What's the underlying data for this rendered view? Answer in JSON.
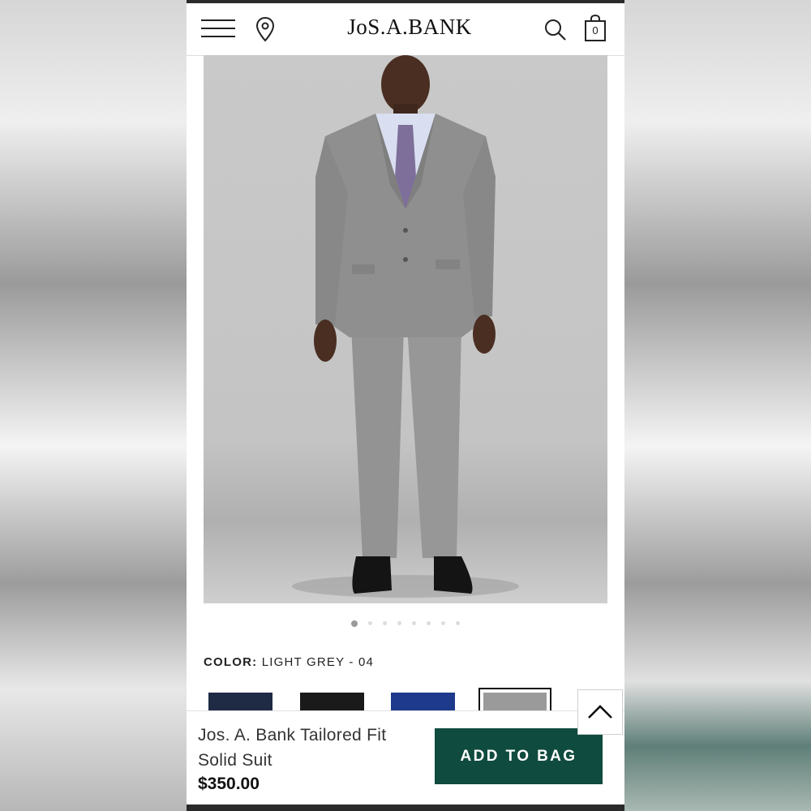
{
  "header": {
    "logo_text": "JoS.A.BANK",
    "bag_count": "0",
    "icons": [
      "hamburger-menu-icon",
      "location-pin-icon",
      "search-icon",
      "shopping-bag-icon"
    ]
  },
  "gallery": {
    "image_description": "Model wearing light grey two-button suit with white shirt and purple patterned tie",
    "total_images": 8,
    "active_index": 0
  },
  "color": {
    "label": "COLOR:",
    "value": "LIGHT GREY - 04",
    "swatches": [
      {
        "name": "navy",
        "hex": "#1f2a44"
      },
      {
        "name": "black",
        "hex": "#1a1a1a"
      },
      {
        "name": "blue",
        "hex": "#1e3a8c"
      },
      {
        "name": "light grey",
        "hex": "#9a9a9a",
        "selected": true
      }
    ]
  },
  "product": {
    "name": "Jos. A. Bank Tailored Fit Solid Suit",
    "price": "$350.00"
  },
  "cta": {
    "add_to_bag_label": "ADD TO BAG"
  },
  "colors": {
    "brand_green": "#0f4b3e"
  }
}
